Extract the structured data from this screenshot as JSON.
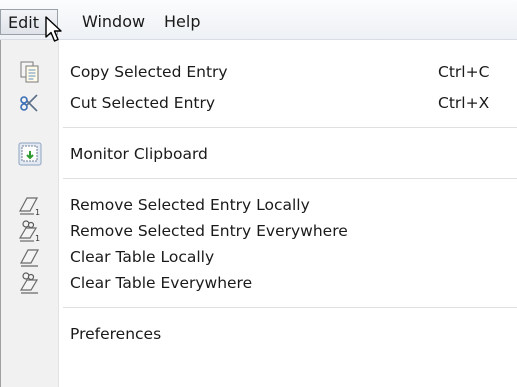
{
  "menubar": {
    "items": [
      {
        "label": "Edit"
      },
      {
        "label": "Window"
      },
      {
        "label": "Help"
      }
    ]
  },
  "edit_menu": {
    "items": [
      {
        "label": "Copy Selected Entry",
        "shortcut": "Ctrl+C",
        "icon": "copy-icon"
      },
      {
        "label": "Cut Selected Entry",
        "shortcut": "Ctrl+X",
        "icon": "scissors-icon"
      },
      {
        "label": "Monitor Clipboard",
        "shortcut": "",
        "icon": "clipboard-monitor-icon"
      },
      {
        "label": "Remove Selected Entry Locally",
        "shortcut": "",
        "icon": "eraser-single-icon"
      },
      {
        "label": "Remove Selected Entry Everywhere",
        "shortcut": "",
        "icon": "eraser-users-single-icon"
      },
      {
        "label": "Clear Table Locally",
        "shortcut": "",
        "icon": "eraser-icon"
      },
      {
        "label": "Clear Table Everywhere",
        "shortcut": "",
        "icon": "eraser-users-icon"
      },
      {
        "label": "Preferences",
        "shortcut": "",
        "icon": ""
      }
    ]
  }
}
